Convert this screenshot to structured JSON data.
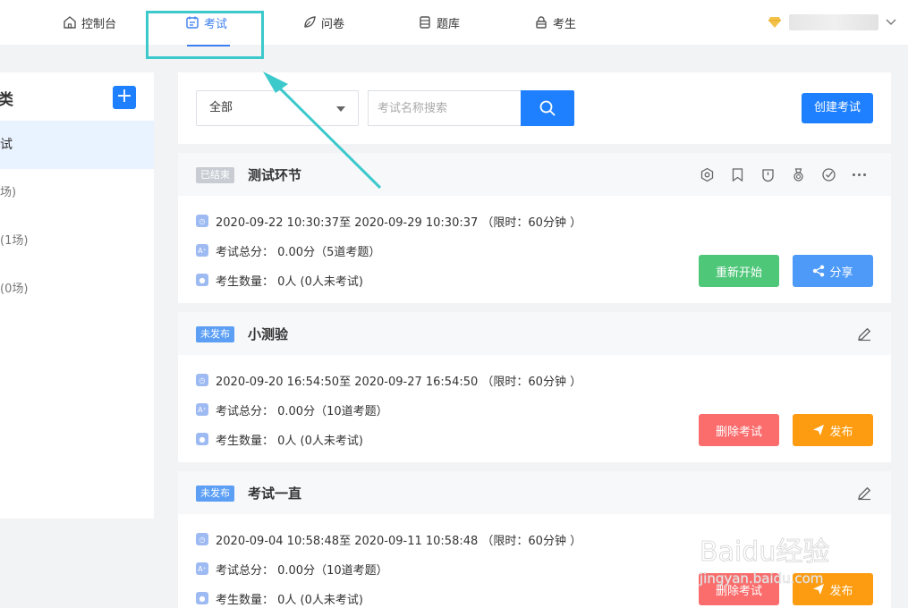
{
  "nav": {
    "items": [
      {
        "label": "控制台",
        "icon": "home-icon"
      },
      {
        "label": "考试",
        "icon": "calendar-icon"
      },
      {
        "label": "问卷",
        "icon": "leaf-icon"
      },
      {
        "label": "题库",
        "icon": "database-icon"
      },
      {
        "label": "考生",
        "icon": "person-lock-icon"
      }
    ],
    "active_index": 1
  },
  "sidebar": {
    "title": "类",
    "items": [
      {
        "label": "试"
      },
      {
        "label": "场)"
      },
      {
        "label": "(1场)"
      },
      {
        "label": "(0场)"
      }
    ]
  },
  "search": {
    "filter_value": "全部",
    "placeholder": "考试名称搜索",
    "create_label": "创建考试"
  },
  "exams": [
    {
      "status": "已结束",
      "title": "测试环节",
      "time": "2020-09-22 10:30:37至 2020-09-29 10:30:37 （限时：60分钟 ）",
      "score": "考试总分： 0.00分（5道考题）",
      "students": "考生数量： 0人 (0人未考试)",
      "buttons": [
        "重新开始",
        "分享"
      ]
    },
    {
      "status": "未发布",
      "title": "小测验",
      "time": "2020-09-20 16:54:50至 2020-09-27 16:54:50 （限时：60分钟 ）",
      "score": "考试总分： 0.00分（10道考题）",
      "students": "考生数量： 0人 (0人未考试)",
      "buttons": [
        "删除考试",
        "发布"
      ]
    },
    {
      "status": "未发布",
      "title": "考试一直",
      "time": "2020-09-04 10:58:48至 2020-09-11 10:58:48 （限时：60分钟 ）",
      "score": "考试总分： 0.00分（10道考题）",
      "students": "考生数量： 0人 (0人未考试)",
      "buttons": [
        "删除考试",
        "发布"
      ]
    }
  ],
  "colors": {
    "accent": "#1e80ff",
    "highlight": "#3cc9cc",
    "green": "#4fc779",
    "red": "#fb6c6c",
    "orange": "#fd9c11"
  },
  "watermark": {
    "brand": "Baidu经验",
    "url": "jingyan.baidu.com"
  }
}
